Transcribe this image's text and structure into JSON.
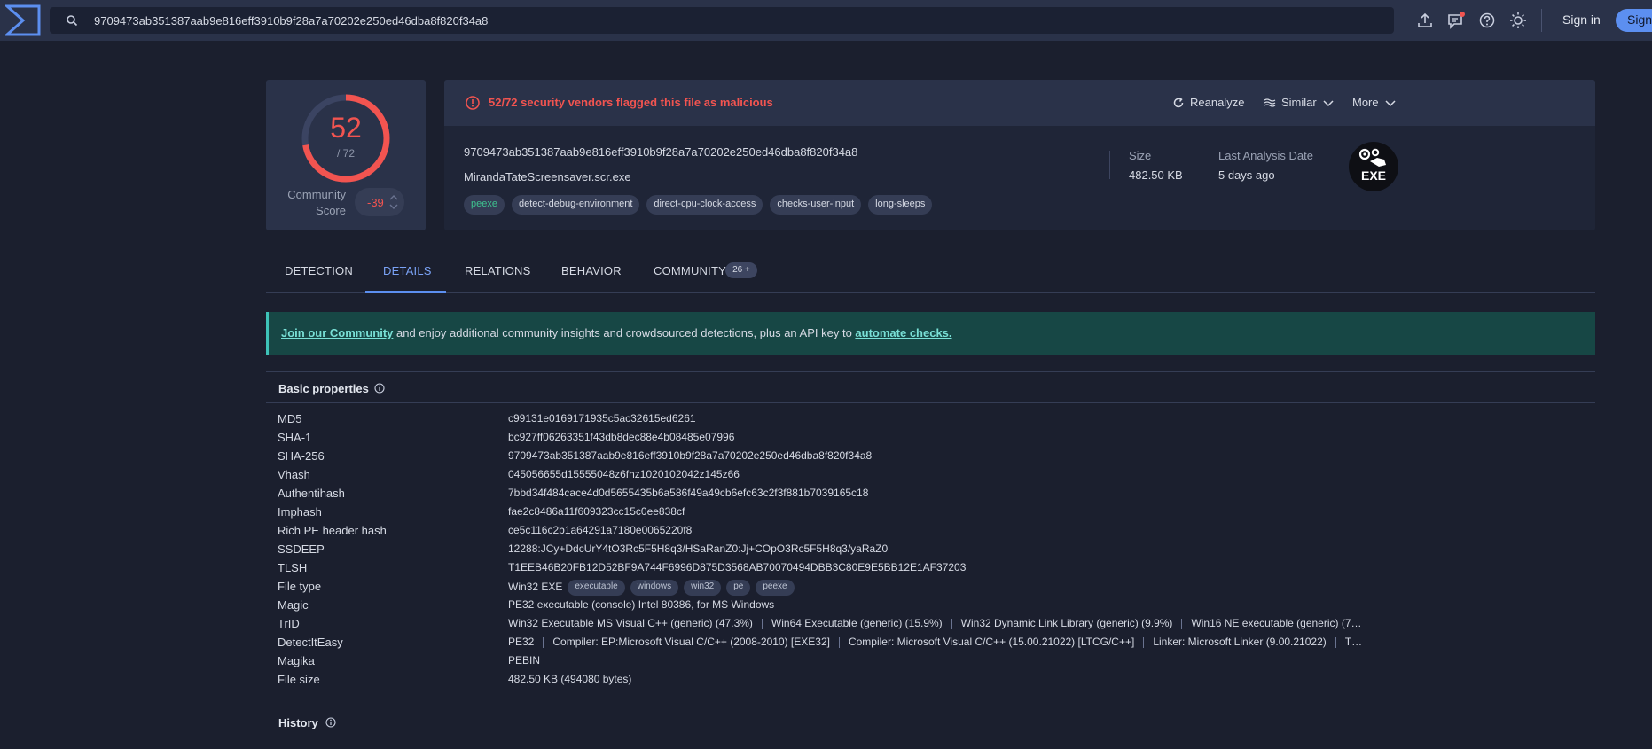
{
  "topbar": {
    "search_value": "9709473ab351387aab9e816eff3910b9f28a7a70202e250ed46dba8f820f34a8",
    "signin": "Sign in",
    "signup": "Sign"
  },
  "score": {
    "detections": "52",
    "total": "/ 72",
    "fraction": 0.722,
    "community_label": "Community Score",
    "community_value": "-39"
  },
  "summary": {
    "alert": "52/72 security vendors flagged this file as malicious",
    "reanalyze": "Reanalyze",
    "similar": "Similar",
    "more": "More",
    "hash": "9709473ab351387aab9e816eff3910b9f28a7a70202e250ed46dba8f820f34a8",
    "filename": "MirandaTateScreensaver.scr.exe",
    "tags": [
      "peexe",
      "detect-debug-environment",
      "direct-cpu-clock-access",
      "checks-user-input",
      "long-sleeps"
    ],
    "size_label": "Size",
    "size_value": "482.50 KB",
    "date_label": "Last Analysis Date",
    "date_value": "5 days ago",
    "file_badge": "EXE"
  },
  "tabs": [
    {
      "label": "DETECTION"
    },
    {
      "label": "DETAILS"
    },
    {
      "label": "RELATIONS"
    },
    {
      "label": "BEHAVIOR"
    },
    {
      "label": "COMMUNITY"
    }
  ],
  "community_badge": "26 +",
  "banner": {
    "link1": "Join our Community",
    "middle": " and enjoy additional community insights and crowdsourced detections, plus an API key to ",
    "link2": "automate checks."
  },
  "basic": {
    "title": "Basic properties",
    "rows": [
      {
        "k": "MD5",
        "v": "c99131e0169171935c5ac32615ed6261"
      },
      {
        "k": "SHA-1",
        "v": "bc927ff06263351f43db8dec88e4b08485e07996"
      },
      {
        "k": "SHA-256",
        "v": "9709473ab351387aab9e816eff3910b9f28a7a70202e250ed46dba8f820f34a8"
      },
      {
        "k": "Vhash",
        "v": "045056655d15555048z6fhz1020102042z145z66"
      },
      {
        "k": "Authentihash",
        "v": "7bbd34f484cace4d0d5655435b6a586f49a49cb6efc63c2f3f881b7039165c18"
      },
      {
        "k": "Imphash",
        "v": "fae2c8486a11f609323cc15c0ee838cf"
      },
      {
        "k": "Rich PE header hash",
        "v": "ce5c116c2b1a64291a7180e0065220f8"
      },
      {
        "k": "SSDEEP",
        "v": "12288:JCy+DdcUrY4tO3Rc5F5H8q3/HSaRanZ0:Jj+COpO3Rc5F5H8q3/yaRaZ0"
      },
      {
        "k": "TLSH",
        "v": "T1EEB46B20FB12D52BF9A744F6996D875D3568AB70070494DBB3C80E9E5BB12E1AF37203"
      },
      {
        "k": "File type",
        "v": "Win32 EXE",
        "chips": [
          "executable",
          "windows",
          "win32",
          "pe",
          "peexe"
        ]
      },
      {
        "k": "Magic",
        "v": "PE32 executable (console) Intel 80386, for MS Windows"
      },
      {
        "k": "TrID",
        "parts": [
          "Win32 Executable MS Visual C++ (generic) (47.3%)",
          "Win64 Executable (generic) (15.9%)",
          "Win32 Dynamic Link Library (generic) (9.9%)",
          "Win16 NE executable (generic) (7…"
        ]
      },
      {
        "k": "DetectItEasy",
        "parts": [
          "PE32",
          "Compiler: EP:Microsoft Visual C/C++ (2008-2010) [EXE32]",
          "Compiler: Microsoft Visual C/C++ (15.00.21022) [LTCG/C++]",
          "Linker: Microsoft Linker (9.00.21022)",
          "T…"
        ]
      },
      {
        "k": "Magika",
        "v": "PEBIN"
      },
      {
        "k": "File size",
        "v": "482.50 KB (494080 bytes)"
      }
    ]
  },
  "history": {
    "title": "History"
  }
}
